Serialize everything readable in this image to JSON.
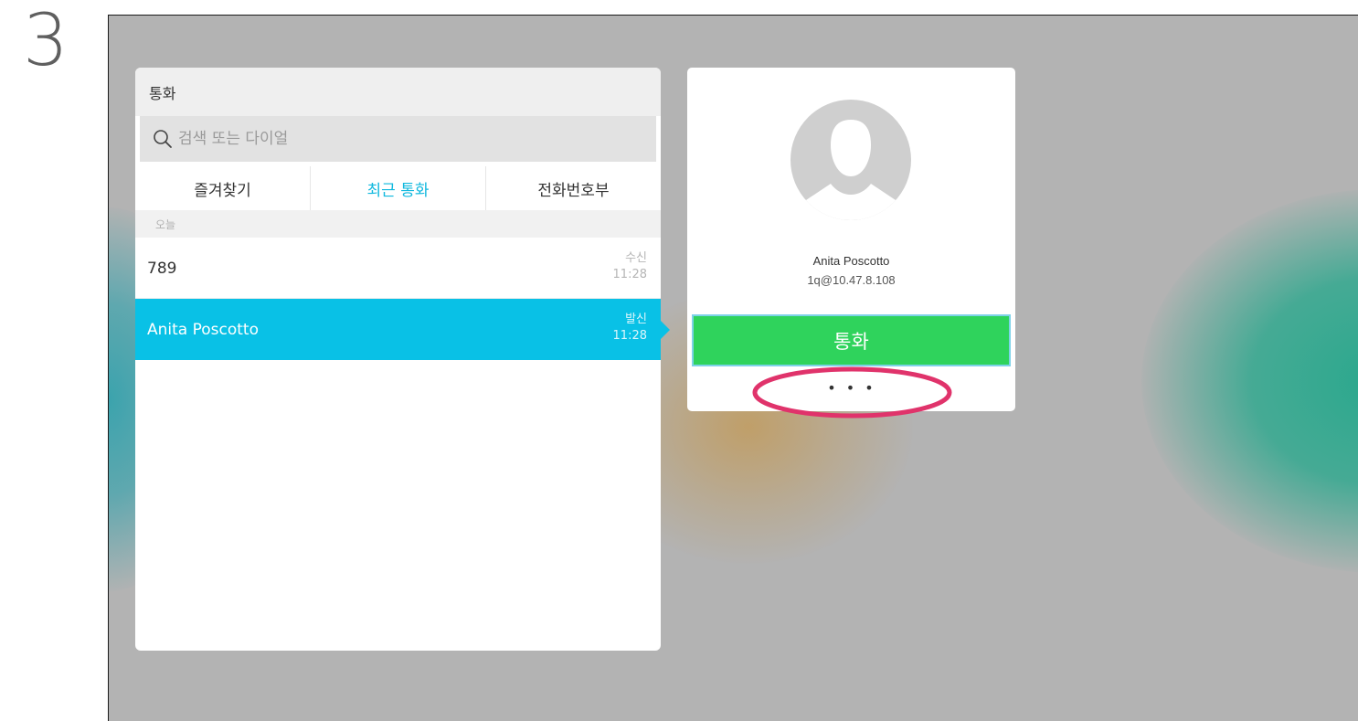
{
  "step_number": "3",
  "call_panel": {
    "title": "통화",
    "search": {
      "placeholder": "검색 또는 다이얼",
      "value": ""
    },
    "tabs": [
      {
        "label": "즐겨찾기",
        "active": false
      },
      {
        "label": "최근 통화",
        "active": true
      },
      {
        "label": "전화번호부",
        "active": false
      }
    ],
    "section_header": "오늘",
    "recent_calls": [
      {
        "name": "789",
        "direction": "수신",
        "time": "11:28",
        "selected": false
      },
      {
        "name": "Anita Poscotto",
        "direction": "발신",
        "time": "11:28",
        "selected": true
      }
    ]
  },
  "contact_card": {
    "avatar_icon": "person-silhouette-icon",
    "name": "Anita Poscotto",
    "address": "1q@10.47.8.108",
    "call_button_label": "통화",
    "more_button_label": "• • •"
  },
  "colors": {
    "accent": "#0fb8de",
    "selected_row": "#09c1e6",
    "call_button": "#2fd35c",
    "highlight": "#e0336b",
    "screen_background": "#b3b3b3"
  }
}
